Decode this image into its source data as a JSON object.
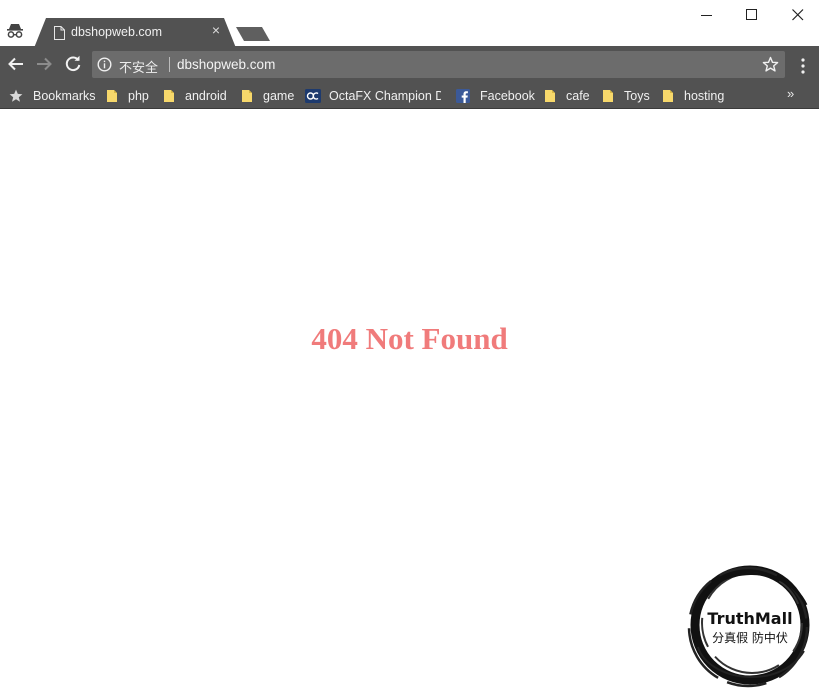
{
  "tab": {
    "title": "dbshopweb.com",
    "close": "×"
  },
  "address": {
    "security": "不安全",
    "url": "dbshopweb.com"
  },
  "bookmarks": {
    "items": [
      {
        "label": "Bookmarks",
        "icon": "star-icon"
      },
      {
        "label": "php",
        "icon": "folder-icon"
      },
      {
        "label": "android",
        "icon": "folder-icon"
      },
      {
        "label": "game",
        "icon": "folder-icon"
      },
      {
        "label": "OctaFX Champion Demo",
        "icon": "octafx-icon"
      },
      {
        "label": "Facebook",
        "icon": "facebook-icon"
      },
      {
        "label": "cafe",
        "icon": "folder-icon"
      },
      {
        "label": "Toys",
        "icon": "folder-icon"
      },
      {
        "label": "hosting",
        "icon": "folder-icon"
      }
    ],
    "overflow": "»"
  },
  "page": {
    "heading": "404 Not Found"
  },
  "watermark": {
    "brand": "TruthMall",
    "slogan": "分真假 防中伏"
  },
  "colors": {
    "toolbar": "#525252",
    "tab": "#525252",
    "omnibox": "#6c6c6c",
    "heading": "#f07b7b",
    "folder": "#f7d86b"
  }
}
